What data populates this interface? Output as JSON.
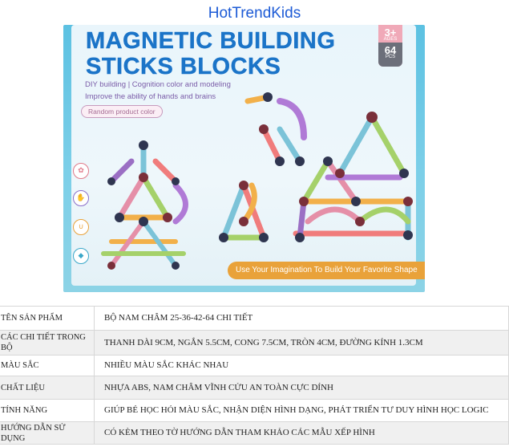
{
  "brand": "HotTrendKids",
  "box": {
    "title_line1": "MAGNETIC BUILDING",
    "title_line2": "STICKS BLOCKS",
    "subtitle1": "DIY building | Cognition color and modeling",
    "subtitle2": "Improve the ability of hands and brains",
    "random_color": "Random product color",
    "age": "3+",
    "age_label": "AGES",
    "pieces": "64",
    "pieces_label": "PCS",
    "banner": "Use Your Imagination To Build Your Favorite Shape"
  },
  "specs": [
    {
      "label": "TÊN SẢN PHẨM",
      "value": "BỘ NAM CHÂM 25-36-42-64 CHI TIẾT"
    },
    {
      "label": "CÁC CHI TIẾT TRONG BỘ",
      "value": "THANH DÀI 9CM, NGẮN 5.5CM,  CONG 7.5CM, TRÒN 4CM, ĐƯỜNG KÍNH 1.3CM"
    },
    {
      "label": "MÀU SẮC",
      "value": "NHIỀU MÀU SẮC KHÁC NHAU"
    },
    {
      "label": "CHẤT LIỆU",
      "value": "NHỰA ABS, NAM CHÂM VĨNH CỬU AN TOÀN CỰC DÍNH"
    },
    {
      "label": "TÍNH NĂNG",
      "value": "GIÚP BÉ HỌC HỎI MÀU SẮC, NHẬN DIỆN HÌNH DẠNG, PHÁT TRIỂN TƯ DUY HÌNH HỌC LOGIC"
    },
    {
      "label": "HƯỚNG DẪN SỬ DỤNG",
      "value": "CÓ KÈM THEO TỜ HƯỚNG DẪN THAM KHẢO CÁC MẪU XẾP HÌNH"
    }
  ]
}
